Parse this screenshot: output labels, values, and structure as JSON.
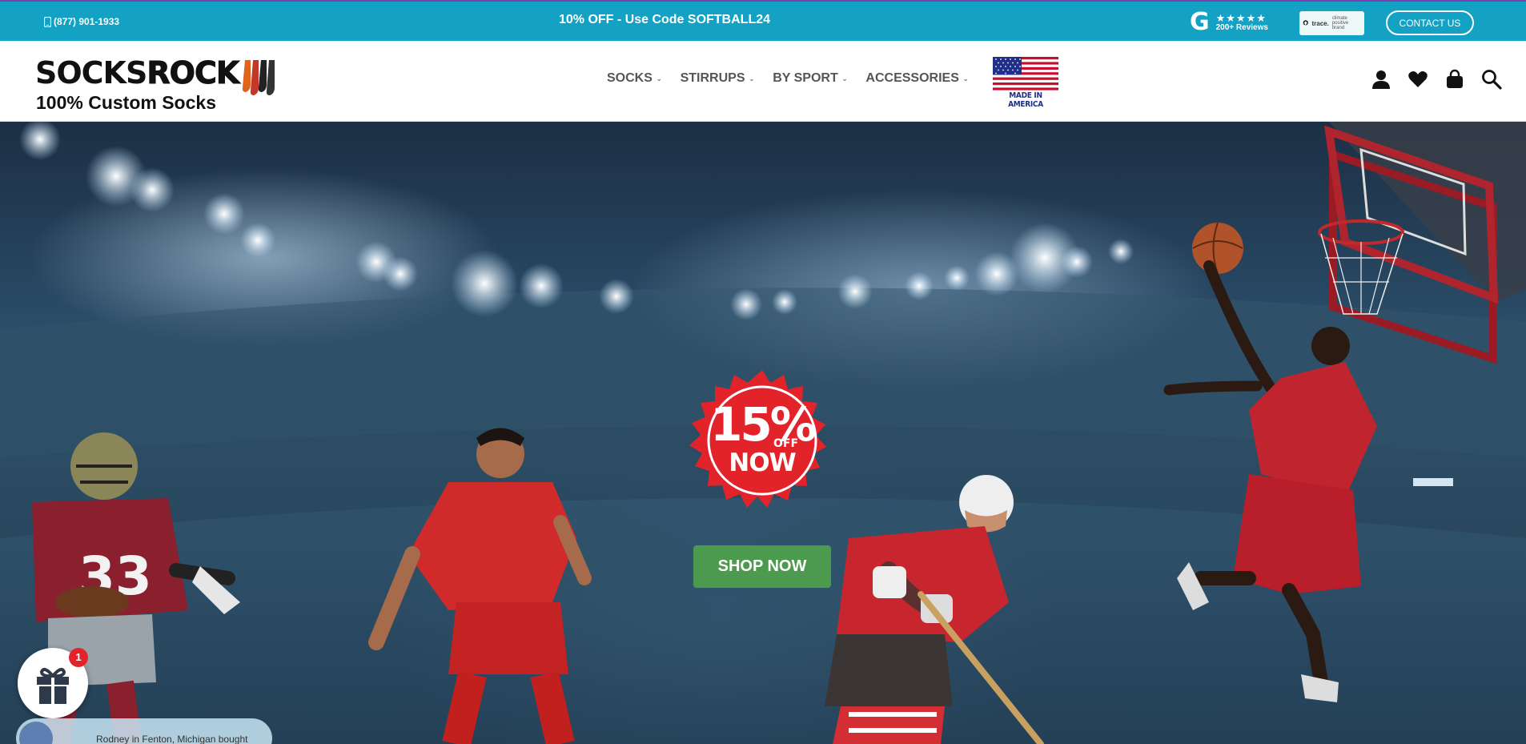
{
  "topbar": {
    "phone": "(877) 901-1933",
    "promo": "10% OFF - Use Code SOFTBALL24",
    "reviews": {
      "stars": "★★★★★",
      "count": "200+ Reviews"
    },
    "trace_badge": {
      "brand": "trace.",
      "label": "climate positive brand"
    },
    "contact_label": "CONTACT US",
    "colors": {
      "background": "#13a1c4",
      "accent_line": "#7b3fb0"
    }
  },
  "header": {
    "logo": {
      "brand_a": "SOCKS",
      "brand_b": "ROCK",
      "tagline": "100% Custom Socks"
    },
    "nav": [
      {
        "label": "SOCKS"
      },
      {
        "label": "STIRRUPS"
      },
      {
        "label": "BY SPORT"
      },
      {
        "label": "ACCESSORIES"
      }
    ],
    "made_in": "MADE IN AMERICA",
    "icons": [
      "account-icon",
      "heart-icon",
      "cart-icon",
      "search-icon"
    ]
  },
  "hero": {
    "badge": {
      "percent": "15%",
      "off": "OFF",
      "now": "NOW",
      "color": "#e3232a"
    },
    "cta_label": "SHOP NOW",
    "cta_color": "#4b9a4e",
    "jersey_number": "33"
  },
  "widgets": {
    "gift_count": "1",
    "toast_text": "Rodney in Fenton, Michigan bought"
  }
}
